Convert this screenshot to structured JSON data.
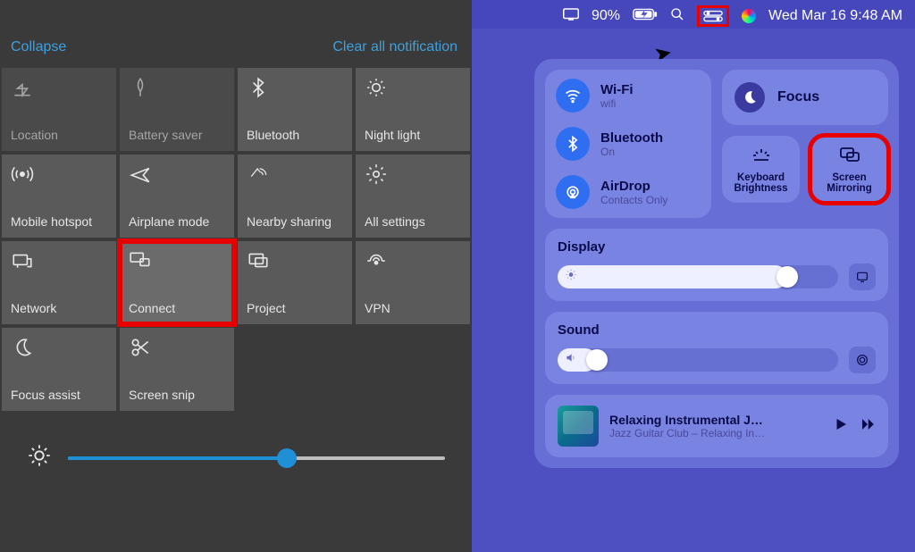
{
  "windows": {
    "collapse": "Collapse",
    "clear_all": "Clear all notification",
    "tiles": {
      "location": "Location",
      "battery_saver": "Battery saver",
      "bluetooth": "Bluetooth",
      "night_light": "Night light",
      "mobile_hotspot": "Mobile hotspot",
      "airplane_mode": "Airplane mode",
      "nearby_sharing": "Nearby sharing",
      "all_settings": "All settings",
      "network": "Network",
      "connect": "Connect",
      "project": "Project",
      "vpn": "VPN",
      "focus_assist": "Focus assist",
      "screen_snip": "Screen snip"
    },
    "brightness_pct": 58
  },
  "mac": {
    "menubar": {
      "battery_pct": "90%",
      "datetime": "Wed Mar 16  9:48 AM"
    },
    "connectivity": {
      "wifi": {
        "title": "Wi-Fi",
        "status": "wifi"
      },
      "bluetooth": {
        "title": "Bluetooth",
        "status": "On"
      },
      "airdrop": {
        "title": "AirDrop",
        "status": "Contacts Only"
      }
    },
    "focus": "Focus",
    "keyboard_brightness": "Keyboard Brightness",
    "screen_mirroring": "Screen Mirroring",
    "display": {
      "title": "Display",
      "value_pct": 82
    },
    "sound": {
      "title": "Sound",
      "value_pct": 14
    },
    "now_playing": {
      "title": "Relaxing Instrumental J…",
      "subtitle": "Jazz Guitar Club – Relaxing In…"
    }
  }
}
